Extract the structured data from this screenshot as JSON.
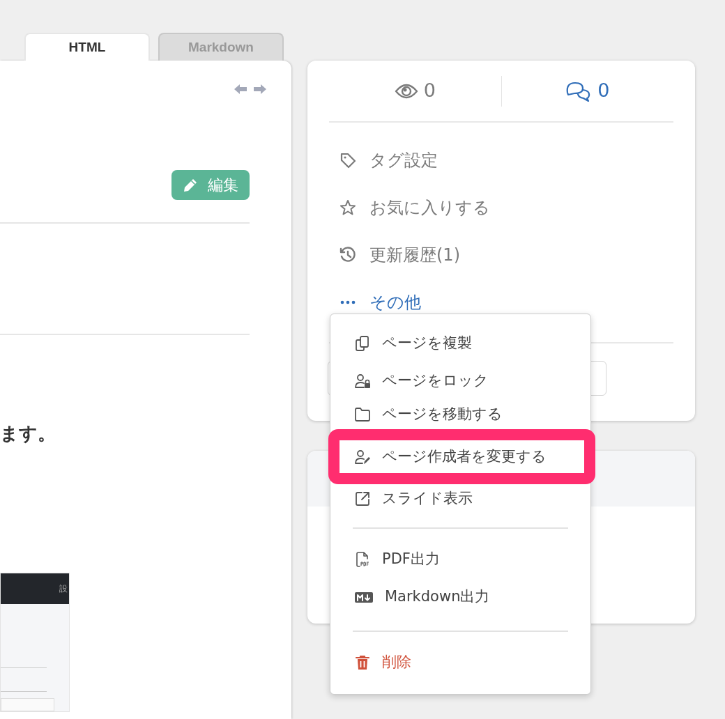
{
  "tabs": [
    {
      "label": "HTML",
      "selected": true
    },
    {
      "label": "Markdown",
      "selected": false
    }
  ],
  "edit_button": "編集",
  "content_text": "ます。",
  "embedded_screenshot": {
    "header_text": "設"
  },
  "stats": {
    "views": "0",
    "comments": "0"
  },
  "actions": [
    {
      "kind": "tag",
      "label": "タグ設定"
    },
    {
      "kind": "star",
      "label": "お気に入りする"
    },
    {
      "kind": "history",
      "label": "更新履歴(1)"
    },
    {
      "kind": "more",
      "label": "その他"
    }
  ],
  "menu": [
    {
      "kind": "copy",
      "label": "ページを複製",
      "highlighted": false
    },
    {
      "kind": "lock",
      "label": "ページをロック",
      "highlighted": false
    },
    {
      "kind": "folder",
      "label": "ページを移動する",
      "highlighted": false
    },
    {
      "kind": "author",
      "label": "ページ作成者を変更する",
      "highlighted": true
    },
    {
      "kind": "slide",
      "label": "スライド表示",
      "highlighted": false
    },
    {
      "kind": "divider"
    },
    {
      "kind": "pdf",
      "label": "PDF出力",
      "highlighted": false
    },
    {
      "kind": "markdown",
      "label": "Markdown出力",
      "highlighted": false
    },
    {
      "kind": "divider"
    },
    {
      "kind": "delete",
      "label": "削除",
      "highlighted": false
    }
  ]
}
